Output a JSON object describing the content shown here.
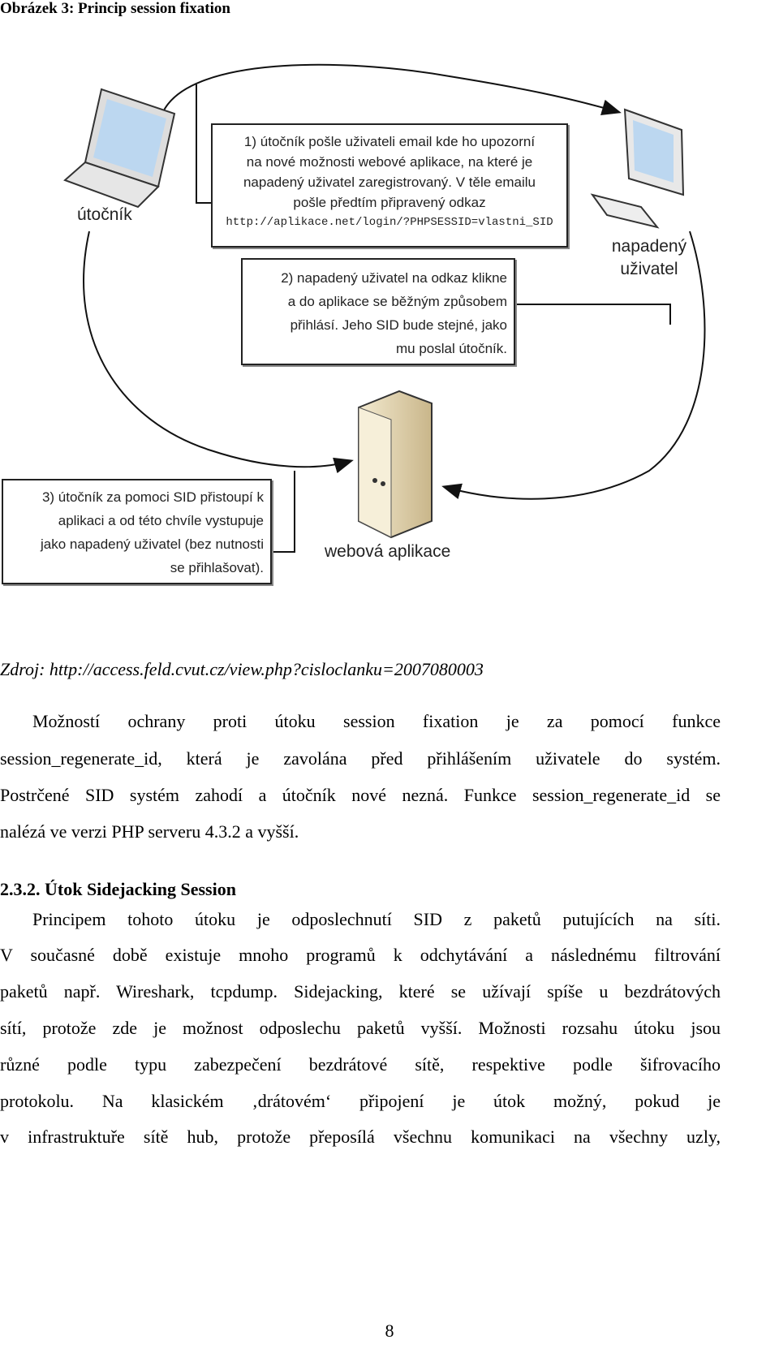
{
  "figure": {
    "caption": "Obrázek 3: Princip session fixation",
    "labels": {
      "attacker": "útočník",
      "victim": [
        "napadený",
        "uživatel"
      ],
      "server": "webová aplikace"
    },
    "step1": [
      "1) útočník pošle uživateli email kde ho upozorní",
      "na nové možnosti webové aplikace, na které je",
      "napadený uživatel zaregistrovaný. V těle emailu",
      "pošle předtím připravený odkaz",
      "http://aplikace.net/login/?PHPSESSID=vlastni_SID"
    ],
    "step2": [
      "2) napadený uživatel na odkaz klikne",
      "a do aplikace se běžným způsobem",
      "přihlásí. Jeho SID bude stejné, jako",
      "mu poslal útočník."
    ],
    "step3": [
      "3) útočník za pomoci SID přistoupí k",
      "aplikaci a od této chvíle vystupuje",
      "jako napadený uživatel (bez nutnosti",
      "se přihlašovat)."
    ]
  },
  "source": "Zdroj: http://access.feld.cvut.cz/view.php?cisloclanku=2007080003",
  "paragraph1": [
    "Možností ochrany proti útoku session fixation je za pomocí funkce",
    "session_regenerate_id, která je zavolána před přihlášením uživatele do systém.",
    "Postrčené SID systém zahodí a útočník nové nezná. Funkce session_regenerate_id se",
    "nalézá ve verzi PHP serveru 4.3.2 a vyšší."
  ],
  "heading": "2.3.2.  Útok Sidejacking Session",
  "paragraph2": [
    "Principem tohoto útoku je odposlechnutí SID z paketů putujících na síti.",
    "V současné době existuje mnoho programů k odchytávání a následnému filtrování",
    "paketů např. Wireshark, tcpdump. Sidejacking, které se užívají spíše u bezdrátových",
    "sítí, protože zde je možnost odposlechu paketů vyšší. Možnosti rozsahu útoku jsou",
    "různé podle typu zabezpečení bezdrátové sítě, respektive podle šifrovacího",
    "protokolu. Na klasickém ‚drátovém‘ připojení je útok možný, pokud je",
    "v infrastruktuře sítě hub, protože přeposílá všechnu komunikaci na všechny uzly,"
  ],
  "page_number": "8"
}
